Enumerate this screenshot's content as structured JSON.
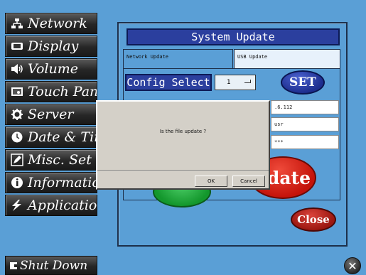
{
  "sidebar": {
    "items": [
      {
        "label": "Network",
        "icon": "network-icon"
      },
      {
        "label": "Display",
        "icon": "display-icon"
      },
      {
        "label": "Volume",
        "icon": "volume-icon"
      },
      {
        "label": "Touch Panel",
        "icon": "touch-panel-icon"
      },
      {
        "label": "Server",
        "icon": "gear-icon"
      },
      {
        "label": "Date & Time",
        "icon": "clock-icon"
      },
      {
        "label": "Misc. Set",
        "icon": "pencil-icon"
      },
      {
        "label": "Information",
        "icon": "info-icon"
      },
      {
        "label": "Application",
        "icon": "lightning-icon"
      }
    ]
  },
  "panel": {
    "title": "System Update",
    "tabs": [
      {
        "label": "Network Update",
        "active": true
      },
      {
        "label": "USB Update",
        "active": false
      }
    ],
    "config_label": "Config Select",
    "config_value": "1",
    "set_label": "SET",
    "fields": [
      ".6.112",
      "usr",
      "***"
    ],
    "update_label": "date",
    "close_label": "Close"
  },
  "dialog": {
    "message": "Is the file update ?",
    "ok_label": "OK",
    "cancel_label": "Cancel"
  },
  "footer": {
    "shutdown_label": "Shut Down",
    "exit_symbol": "✕"
  },
  "colors": {
    "background": "#5a9fd6",
    "title_bar": "#2b3f9e",
    "update_button": "#d61e12",
    "set_button": "#1d2d8e",
    "close_button": "#b01c14"
  }
}
